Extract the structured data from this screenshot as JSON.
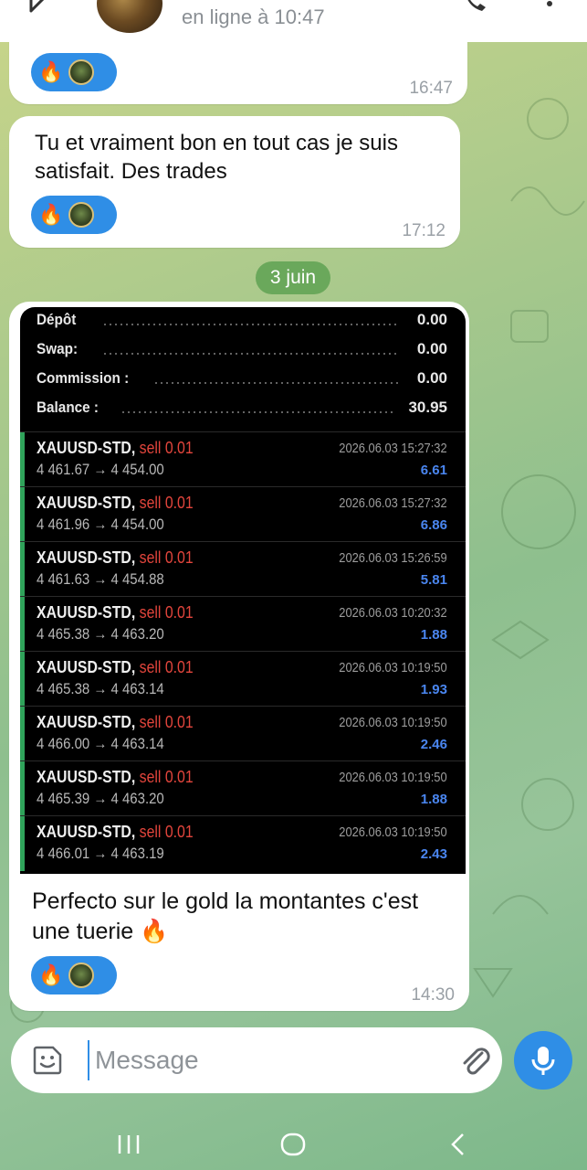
{
  "header": {
    "status": "en ligne à 10:47"
  },
  "messages": [
    {
      "reaction": {
        "emoji": "🔥",
        "avatar_icon": "user-avatar"
      },
      "time": "16:47"
    },
    {
      "text_line1": "Tu et vraiment bon en tout cas je suis",
      "text_line2": "satisfait. Des trades",
      "reaction": {
        "emoji": "🔥",
        "avatar_icon": "user-avatar"
      },
      "time": "17:12"
    },
    {
      "caption_line1": "Perfecto sur le gold  la montantes c'est",
      "caption_line2": "une tuerie 🔥",
      "reaction": {
        "emoji": "🔥",
        "avatar_icon": "user-avatar"
      },
      "time": "14:30"
    }
  ],
  "date_chip": "3 juin",
  "summary": [
    {
      "label": "Dépôt",
      "value": "0.00"
    },
    {
      "label": "Swap:",
      "value": "0.00"
    },
    {
      "label": "Commission :",
      "value": "0.00"
    },
    {
      "label": "Balance :",
      "value": "30.95"
    }
  ],
  "trades": [
    {
      "symbol": "XAUUSD-STD,",
      "side": "sell 0.01",
      "prices": "4 461.67 → 4 454.00",
      "time": "2026.06.03 15:27:32",
      "profit": "6.61"
    },
    {
      "symbol": "XAUUSD-STD,",
      "side": "sell 0.01",
      "prices": "4 461.96 → 4 454.00",
      "time": "2026.06.03 15:27:32",
      "profit": "6.86"
    },
    {
      "symbol": "XAUUSD-STD,",
      "side": "sell 0.01",
      "prices": "4 461.63 → 4 454.88",
      "time": "2026.06.03 15:26:59",
      "profit": "5.81"
    },
    {
      "symbol": "XAUUSD-STD,",
      "side": "sell 0.01",
      "prices": "4 465.38 → 4 463.20",
      "time": "2026.06.03 10:20:32",
      "profit": "1.88"
    },
    {
      "symbol": "XAUUSD-STD,",
      "side": "sell 0.01",
      "prices": "4 465.38 → 4 463.14",
      "time": "2026.06.03 10:19:50",
      "profit": "1.93"
    },
    {
      "symbol": "XAUUSD-STD,",
      "side": "sell 0.01",
      "prices": "4 466.00 → 4 463.14",
      "time": "2026.06.03 10:19:50",
      "profit": "2.46"
    },
    {
      "symbol": "XAUUSD-STD,",
      "side": "sell 0.01",
      "prices": "4 465.39 → 4 463.20",
      "time": "2026.06.03 10:19:50",
      "profit": "1.88"
    },
    {
      "symbol": "XAUUSD-STD,",
      "side": "sell 0.01",
      "prices": "4 466.01 → 4 463.19",
      "time": "2026.06.03 10:19:50",
      "profit": "2.43"
    }
  ],
  "input": {
    "placeholder": "Message"
  },
  "icons": {
    "sticker": "sticker-icon",
    "attach": "paperclip-icon",
    "mic": "microphone-icon",
    "call": "phone-icon",
    "more": "more-vertical-icon",
    "back": "arrow-left-icon"
  },
  "colors": {
    "accent": "#2f8ee6",
    "date_chip": "#6aa85b",
    "sell": "#e2453c",
    "profit": "#4a86f0",
    "buy_bar": "#2fa35a"
  }
}
